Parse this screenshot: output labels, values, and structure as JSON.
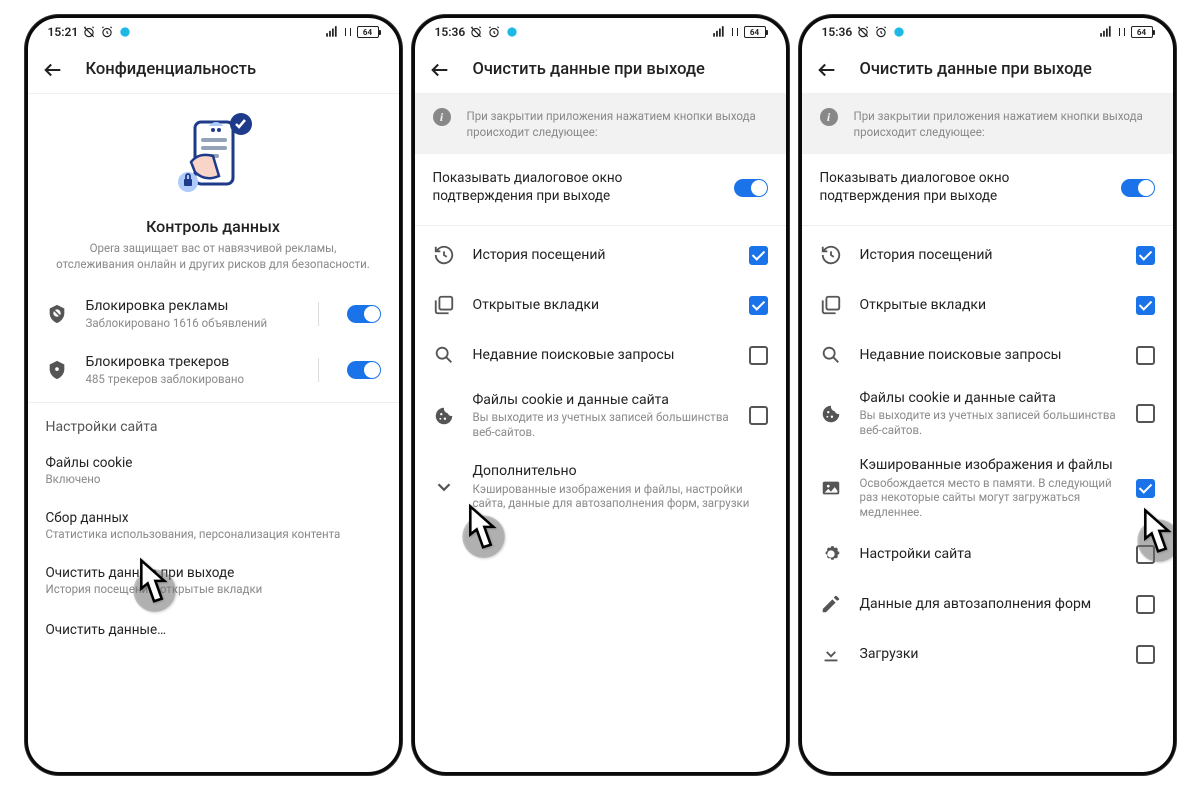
{
  "status": {
    "time_a": "15:21",
    "time_b": "15:36",
    "batt": "64"
  },
  "phone1": {
    "title": "Конфиденциальность",
    "hero_title": "Контроль данных",
    "hero_sub": "Opera защищает вас от навязчивой рекламы, отслеживания онлайн и других рисков для безопасности.",
    "adblock": {
      "title": "Блокировка рекламы",
      "sub": "Заблокировано 1616 объявлений"
    },
    "trackers": {
      "title": "Блокировка трекеров",
      "sub": "485 трекеров заблокировано"
    },
    "sec": "Настройки сайта",
    "cookies": {
      "title": "Файлы cookie",
      "sub": "Включено"
    },
    "collect": {
      "title": "Сбор данных",
      "sub": "Статистика использования, персонализация контента"
    },
    "clearexit": {
      "title": "Очистить данные при выходе",
      "sub": "История посещений, открытые вкладки"
    },
    "cleardata": "Очистить данные…"
  },
  "phone2": {
    "title": "Очистить данные при выходе",
    "banner": "При закрытии приложения нажатием кнопки выхода происходит следующее:",
    "confirm": "Показывать диалоговое окно подтверждения при выходе",
    "history": "История посещений",
    "tabs": "Открытые вкладки",
    "searches": "Недавние поисковые запросы",
    "cookies_t": "Файлы cookie и данные сайта",
    "cookies_s": "Вы выходите из учетных записей большинства веб-сайтов.",
    "more_t": "Дополнительно",
    "more_s": "Кэшированные изображения и файлы, настройки сайта, данные для автозаполнения форм, загрузки"
  },
  "phone3": {
    "cache_t": "Кэшированные изображения и файлы",
    "cache_s": "Освобождается место в памяти. В следующий раз некоторые сайты могут загружаться медленнее.",
    "site": "Настройки сайта",
    "autofill": "Данные для автозаполнения форм",
    "downloads": "Загрузки"
  }
}
